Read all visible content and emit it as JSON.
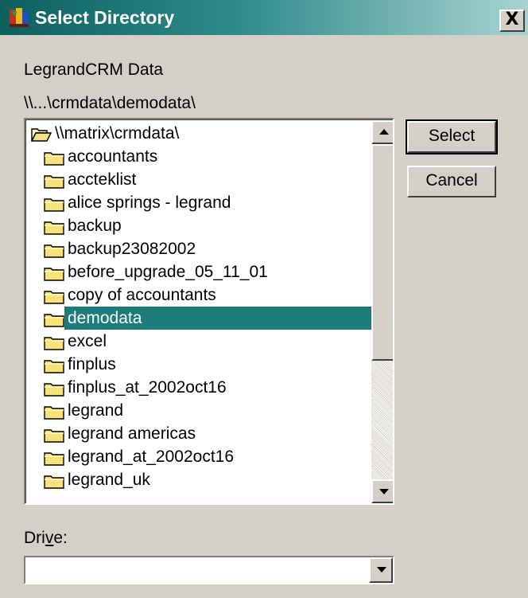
{
  "window": {
    "title": "Select Directory",
    "close_label": "X",
    "titlebar_color": "#1e7b7b"
  },
  "labels": {
    "database": "LegrandCRM Data",
    "path": "\\\\...\\crmdata\\demodata\\",
    "drive_prefix": "Dri",
    "drive_accel": "v",
    "drive_suffix": "e:"
  },
  "folders": {
    "root": "\\\\matrix\\crmdata\\",
    "items": [
      "accountants",
      "accteklist",
      "alice springs - legrand",
      "backup",
      "backup23082002",
      "before_upgrade_05_11_01",
      "copy of accountants",
      "demodata",
      "excel",
      "finplus",
      "finplus_at_2002oct16",
      "legrand",
      "legrand americas",
      "legrand_at_2002oct16",
      "legrand_uk"
    ],
    "selected": "demodata"
  },
  "buttons": {
    "select": "Select",
    "cancel": "Cancel"
  },
  "drive": {
    "value": ""
  },
  "icons": {
    "app": "app-icon",
    "folder": "folder-icon",
    "open_folder": "open-folder-icon",
    "close": "close-icon",
    "scroll_up": "scroll-up-arrow-icon",
    "scroll_down": "scroll-down-arrow-icon",
    "dropdown": "dropdown-arrow-icon"
  }
}
